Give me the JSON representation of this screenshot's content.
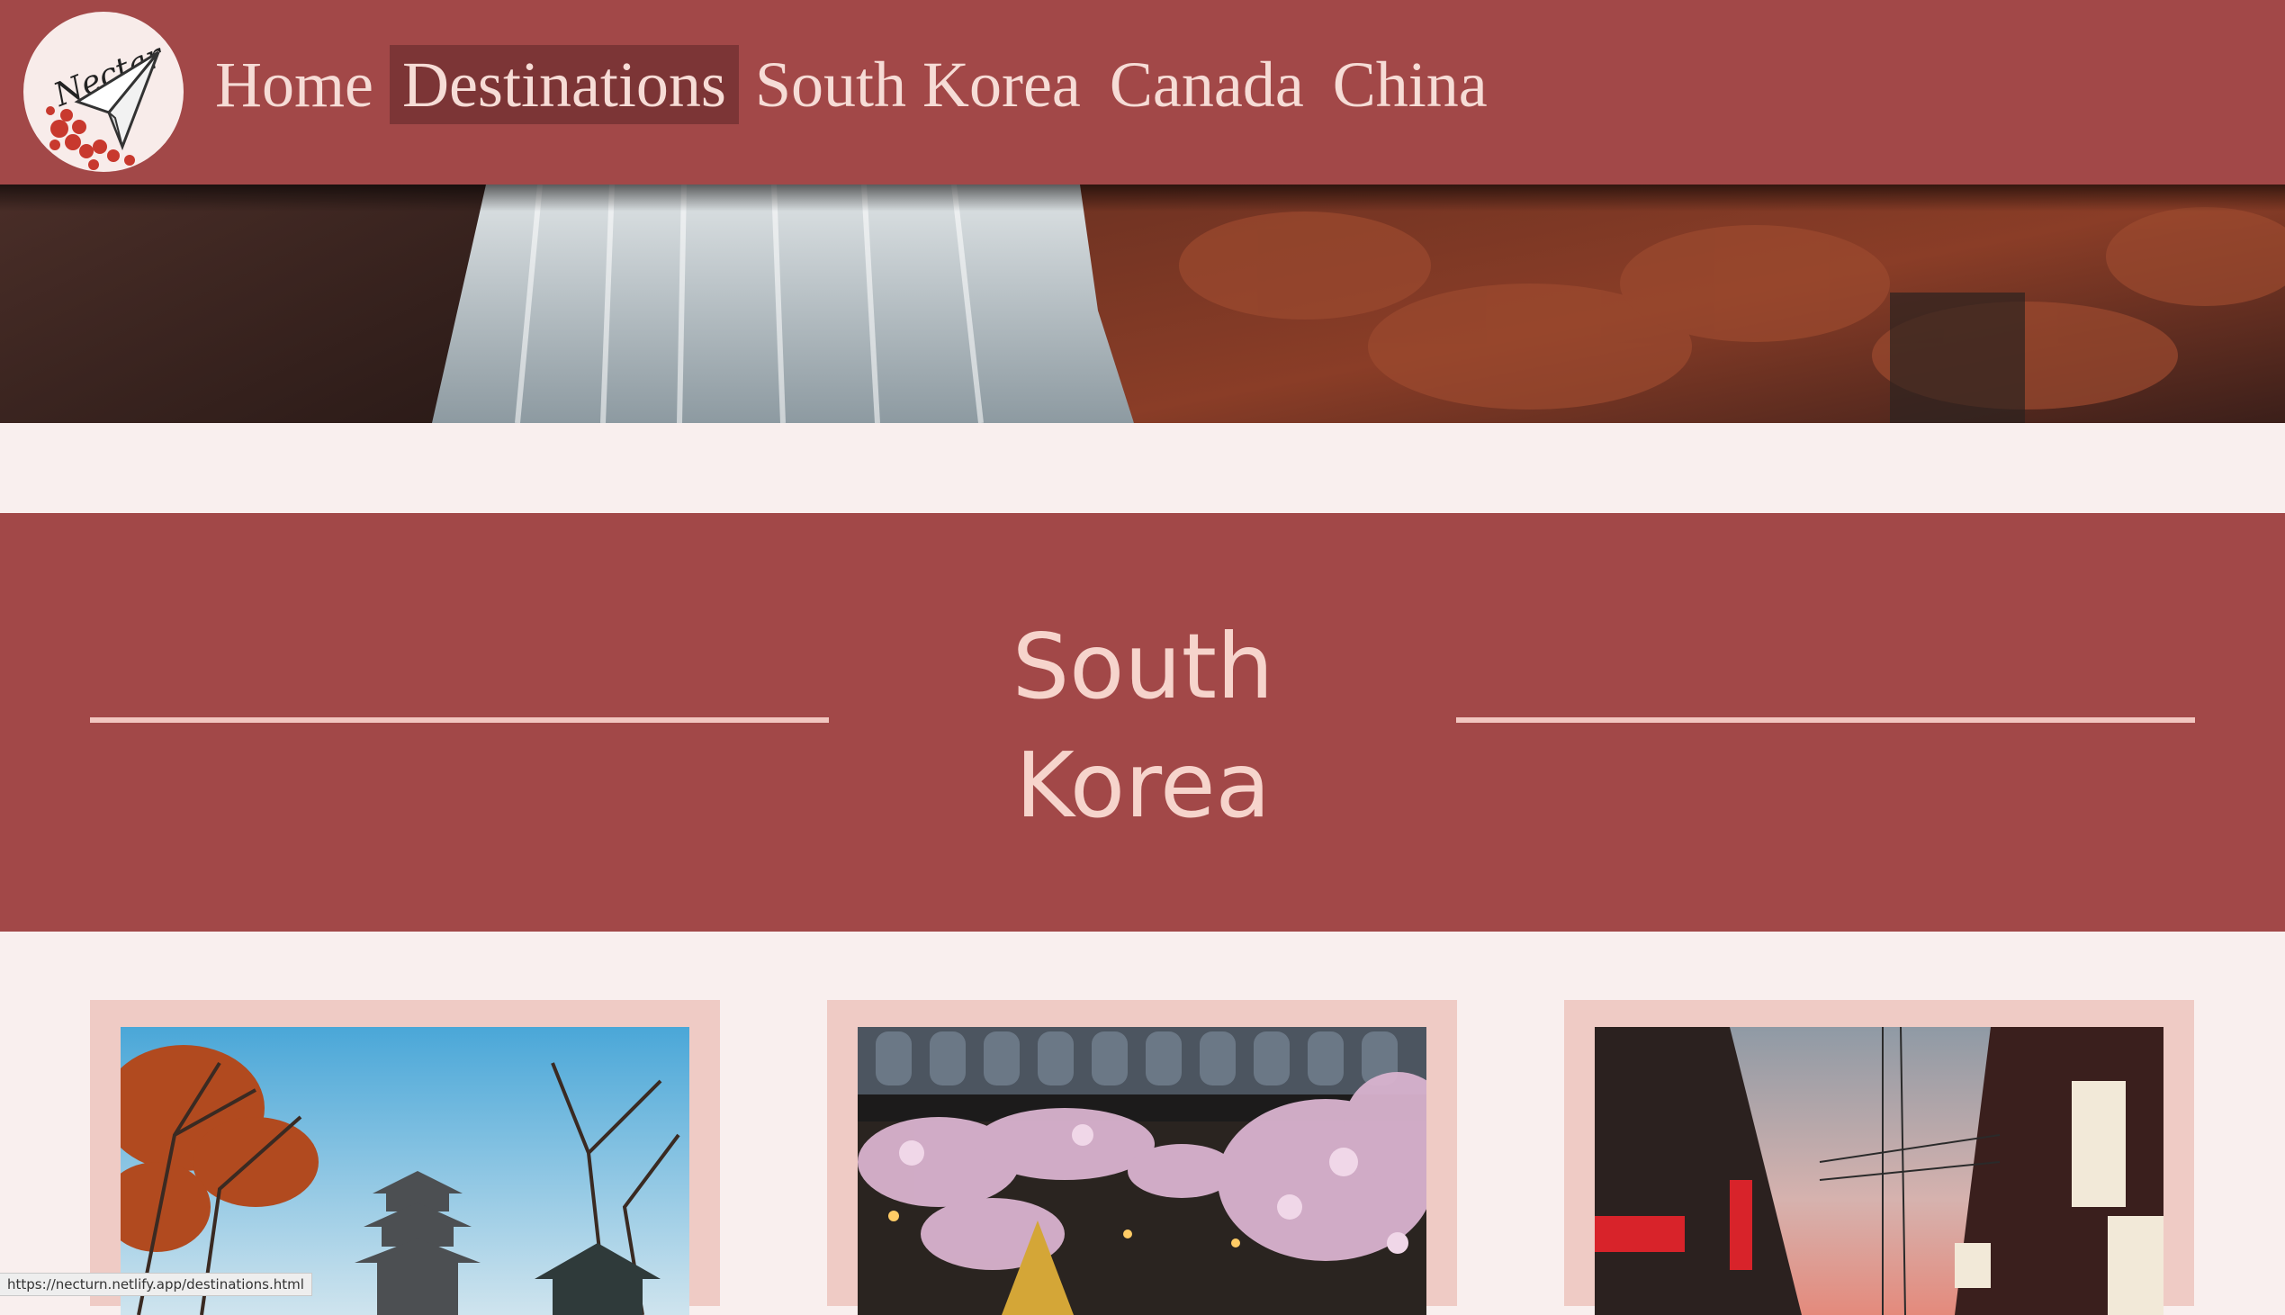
{
  "header": {
    "logo_text": "Nectar",
    "nav": [
      {
        "label": "Home"
      },
      {
        "label": "Destinations",
        "active": true
      },
      {
        "label": "South Korea"
      },
      {
        "label": "Canada"
      },
      {
        "label": "China"
      }
    ]
  },
  "section": {
    "title": "South Korea"
  },
  "status_bar": {
    "url": "https://necturn.netlify.app/destinations.html"
  },
  "colors": {
    "primary": "#a24848",
    "active_nav": "#7c3536",
    "accent_text": "#f6d4cc",
    "background": "#f9efee",
    "card": "#efcbc5"
  }
}
